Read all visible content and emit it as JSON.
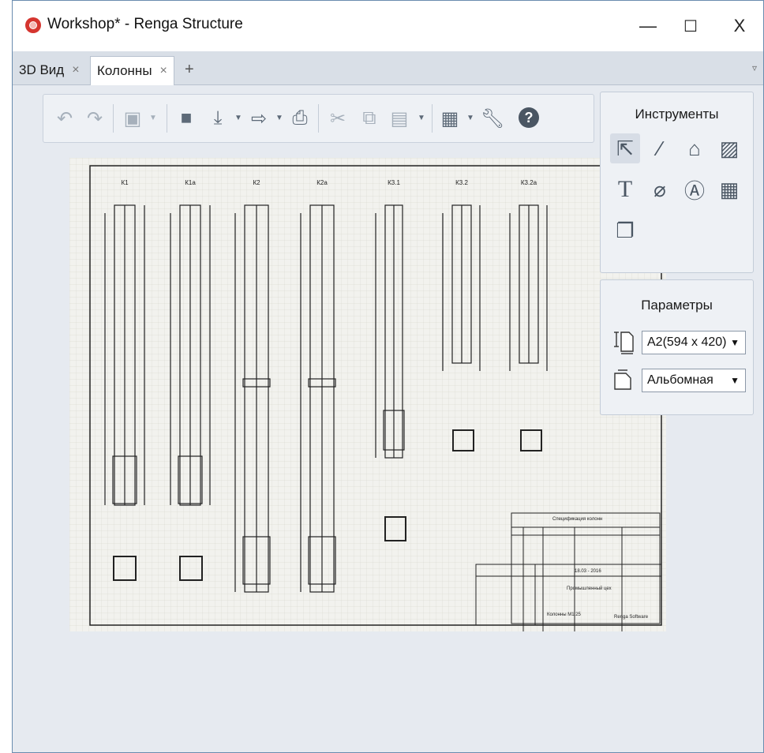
{
  "window": {
    "title": "Workshop* - Renga Structure",
    "controls": {
      "minimize": "—",
      "maximize": "☐",
      "close": "X"
    }
  },
  "tabs": [
    {
      "label": "3D Вид",
      "close": "×"
    },
    {
      "label": "Колонны",
      "close": "×"
    }
  ],
  "tab_add": "+",
  "tab_menu": "▿",
  "toolbar": {
    "undo_icon": "undo-icon",
    "redo_icon": "redo-icon",
    "view_icon": "view-cube-icon",
    "open_icon": "folder-icon",
    "import_icon": "import-icon",
    "export_icon": "export-icon",
    "print_icon": "print-icon",
    "cut_icon": "scissors-icon",
    "copy_icon": "copy-icon",
    "paste_icon": "paste-icon",
    "settings_icon": "settings-icon",
    "options_icon": "wrench-icon",
    "help_label": "?"
  },
  "tools_panel": {
    "title": "Инструменты",
    "tools": [
      "select-icon",
      "line-icon",
      "view-placement-icon",
      "hatch-icon",
      "text-icon",
      "dimension-icon",
      "annotation-icon",
      "table-icon",
      "drawing-sheet-icon"
    ]
  },
  "params_panel": {
    "title": "Параметры",
    "format_value": "A2(594 x 420)",
    "orientation_value": "Альбомная",
    "dropdown_arrow": "▼"
  },
  "drawing": {
    "column_labels": [
      "К1",
      "К1а",
      "К2",
      "К2а",
      "К3.1",
      "К3.2",
      "К3.2а"
    ],
    "spec_title": "Спецификация колонн",
    "stamp_code": "18.03 - 2016",
    "stamp_title": "Промышленный цех",
    "stamp_sheet": "Колонны М1:25",
    "stamp_org": "Renga Software"
  },
  "colors": {
    "accent": "#d5352f",
    "workspace": "#e6eaf0",
    "paper": "#f2f2ee"
  }
}
